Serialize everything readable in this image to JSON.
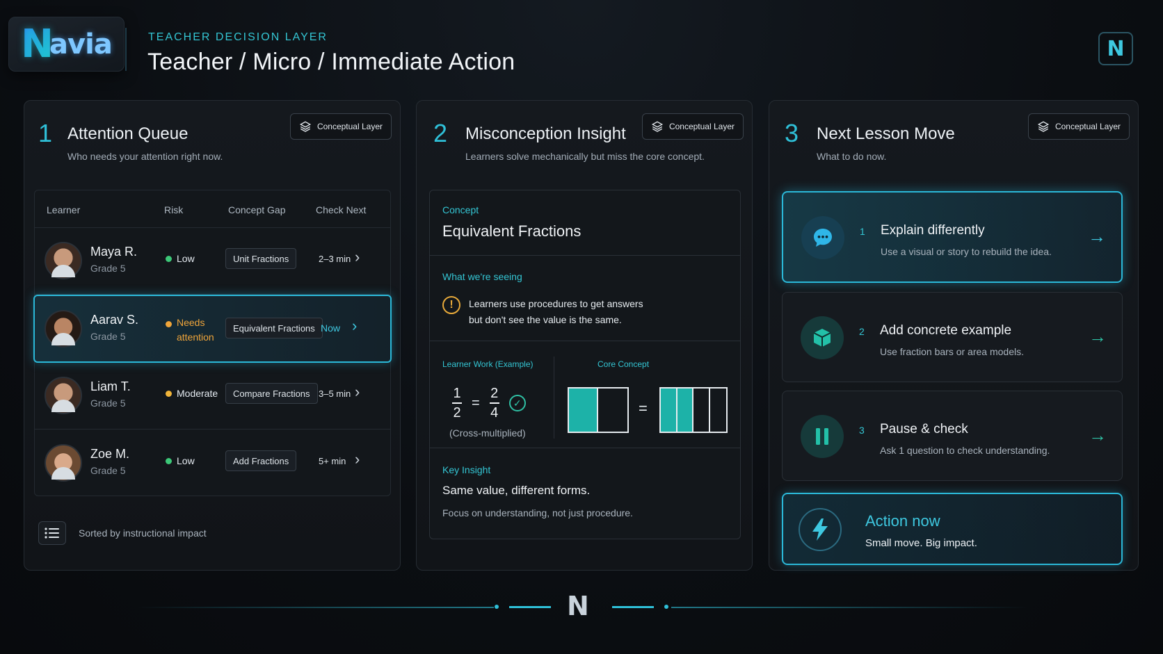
{
  "header": {
    "logo_text": "avia",
    "logo_letter": "N",
    "eyebrow": "TEACHER DECISION LAYER",
    "title": "Teacher / Micro / Immediate Action",
    "corner_logo": "N"
  },
  "badge_label": "Conceptual Layer",
  "attention": {
    "num": "1",
    "title": "Attention Queue",
    "subtitle": "Who needs your attention right now.",
    "columns": [
      "Learner",
      "Risk",
      "Concept Gap",
      "Check Next"
    ],
    "rows": [
      {
        "name": "Maya R.",
        "grade": "Grade 5",
        "risk": "Low",
        "risk_color": "#3cc878",
        "gap": "Unit Fractions",
        "check": "2–3 min"
      },
      {
        "name": "Aarav S.",
        "grade": "Grade 5",
        "risk_line1": "Needs",
        "risk_line2": "attention",
        "risk_color": "#f0a53a",
        "gap": "Equivalent Fractions",
        "check": "Now"
      },
      {
        "name": "Liam T.",
        "grade": "Grade 5",
        "risk": "Moderate",
        "risk_color": "#f0b43a",
        "gap": "Compare Fractions",
        "check": "3–5 min"
      },
      {
        "name": "Zoe M.",
        "grade": "Grade 5",
        "risk": "Low",
        "risk_color": "#3cc878",
        "gap": "Add Fractions",
        "check": "5+ min"
      }
    ],
    "footer": "Sorted by instructional impact",
    "icons": {
      "list": "list-icon",
      "chevron": "chevron-right-icon",
      "layers": "layers-icon"
    }
  },
  "misconception": {
    "num": "2",
    "title": "Misconception Insight",
    "subtitle": "Learners solve mechanically but miss the core concept.",
    "concept_label": "Concept",
    "concept_name": "Equivalent Fractions",
    "seeing_label": "What we're seeing",
    "seeing_text_1": "Learners use procedures to get answers",
    "seeing_text_2": "but don't see the value is the same.",
    "work_label": "Learner Work (Example)",
    "core_label": "Core Concept",
    "frac1_num": "1",
    "frac1_den": "2",
    "frac2_num": "2",
    "frac2_den": "4",
    "equals": "=",
    "work_note": "(Cross-multiplied)",
    "insight_label": "Key Insight",
    "insight_title": "Same value, different forms.",
    "insight_text": "Focus on understanding, not just procedure.",
    "bar_fill_left": 0.5,
    "bar_fill_right": 0.5
  },
  "next_move": {
    "num": "3",
    "title": "Next Lesson Move",
    "subtitle": "What to do now.",
    "moves": [
      {
        "num": "1",
        "title": "Explain differently",
        "sub": "Use a visual or story to rebuild the idea.",
        "icon": "chat-bubble-icon"
      },
      {
        "num": "2",
        "title": "Add concrete example",
        "sub": "Use fraction bars or area models.",
        "icon": "cube-icon"
      },
      {
        "num": "3",
        "title": "Pause & check",
        "sub": "Ask 1 question to check understanding.",
        "icon": "pause-icon"
      }
    ],
    "action_title": "Action now",
    "action_sub": "Small move. Big impact.",
    "arrow": "→"
  },
  "footer": {
    "logo": "N"
  },
  "colors": {
    "accent": "#2fc0d8",
    "teal": "#1db2a8",
    "warning": "#f0a53a",
    "success": "#3cc878"
  }
}
